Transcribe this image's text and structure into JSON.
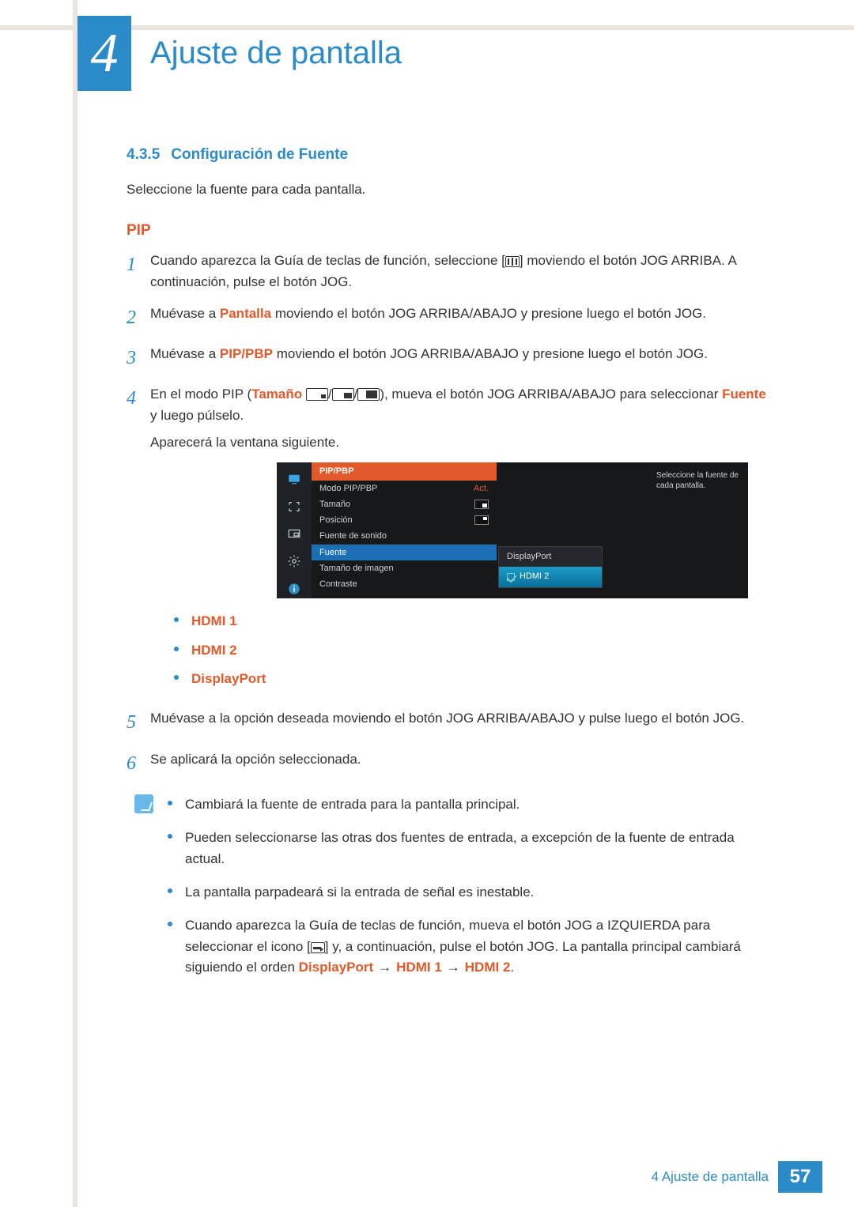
{
  "chapter": {
    "number": "4",
    "title": "Ajuste de pantalla"
  },
  "section": {
    "number": "4.3.5",
    "title": "Configuración de Fuente"
  },
  "intro": "Seleccione la fuente para cada pantalla.",
  "pip_heading": "PIP",
  "steps": {
    "s1": {
      "a": "Cuando aparezca la Guía de teclas de función, seleccione [",
      "b": "] moviendo el botón JOG ARRIBA. A continuación, pulse el botón JOG."
    },
    "s2": {
      "a": "Muévase a ",
      "hl": "Pantalla",
      "b": " moviendo el botón JOG ARRIBA/ABAJO y presione luego el botón JOG."
    },
    "s3": {
      "a": "Muévase a ",
      "hl": "PIP/PBP",
      "b": " moviendo el botón JOG ARRIBA/ABAJO y presione luego el botón JOG."
    },
    "s4": {
      "a": "En el modo PIP (",
      "hl": "Tamaño",
      "b": "), mueva el botón JOG ARRIBA/ABAJO para seleccionar ",
      "hl2": "Fuente",
      "c": " y luego púlselo.",
      "after": "Aparecerá la ventana siguiente."
    },
    "s5": "Muévase a la opción deseada moviendo el botón JOG ARRIBA/ABAJO y pulse luego el botón JOG.",
    "s6": "Se aplicará la opción seleccionada."
  },
  "source_options": [
    "HDMI 1",
    "HDMI 2",
    "DisplayPort"
  ],
  "osd": {
    "title": "PIP/PBP",
    "desc": "Seleccione la fuente de cada pantalla.",
    "rows": {
      "mode": "Modo PIP/PBP",
      "mode_val": "Act.",
      "size": "Tamaño",
      "pos": "Posición",
      "sound": "Fuente de sonido",
      "source": "Fuente",
      "imgsize": "Tamaño de imagen",
      "contrast": "Contraste"
    },
    "dropdown": {
      "opt1": "DisplayPort",
      "opt2": "HDMI 2"
    }
  },
  "notes": {
    "n1": "Cambiará la fuente de entrada para la pantalla principal.",
    "n2": "Pueden seleccionarse las otras dos fuentes de entrada, a excepción de la fuente de entrada actual.",
    "n3": "La pantalla parpadeará si la entrada de señal es inestable.",
    "n4": {
      "a": "Cuando aparezca la Guía de teclas de función, mueva el botón JOG a IZQUIERDA para seleccionar el icono [",
      "b": "] y, a continuación, pulse el botón JOG. La pantalla principal cambiará siguiendo el orden ",
      "seq1": "DisplayPort",
      "seq2": "HDMI 1",
      "seq3": "HDMI 2"
    }
  },
  "footer": {
    "label": "4 Ajuste de pantalla",
    "page": "57"
  }
}
